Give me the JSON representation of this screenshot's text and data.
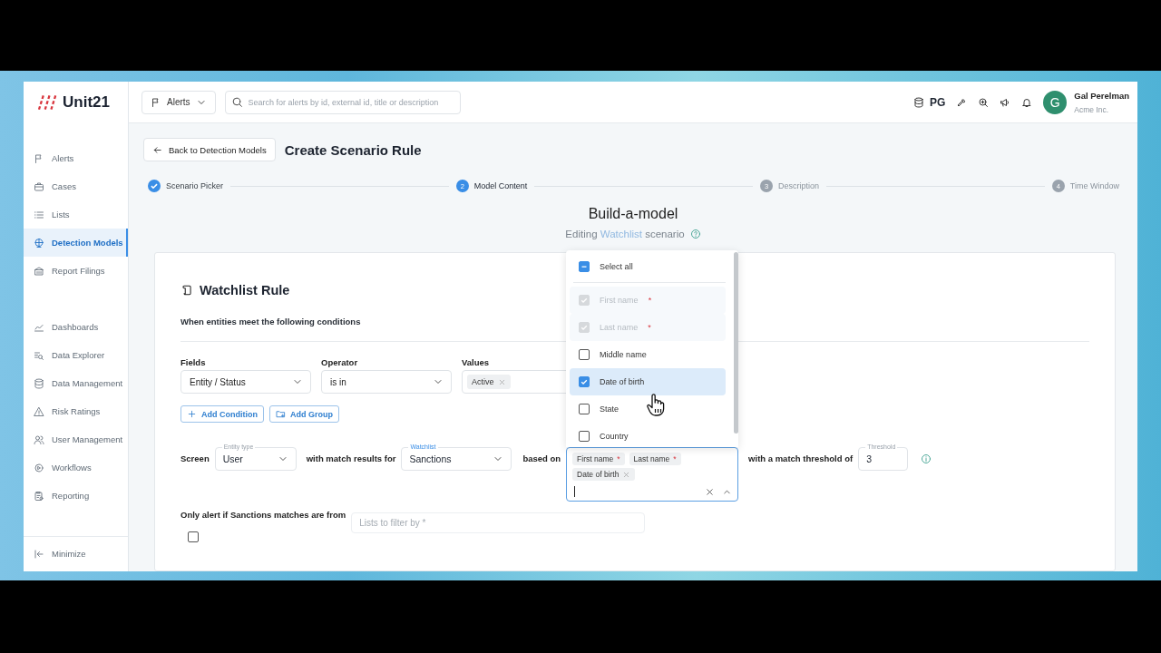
{
  "logo": {
    "text": "Unit21"
  },
  "header": {
    "menu": {
      "label": "Alerts"
    },
    "search": {
      "placeholder": "Search for alerts by id, external id, title or description"
    },
    "db_label": "PG",
    "user": {
      "initial": "G",
      "name": "Gal Perelman",
      "org": "Acme Inc."
    }
  },
  "sidebar": {
    "groups": [
      {
        "items": [
          {
            "label": "Alerts",
            "selected": false
          },
          {
            "label": "Cases",
            "selected": false
          },
          {
            "label": "Lists",
            "selected": false
          },
          {
            "label": "Detection Models",
            "selected": true
          },
          {
            "label": "Report Filings",
            "selected": false
          }
        ]
      },
      {
        "items": [
          {
            "label": "Dashboards",
            "selected": false
          },
          {
            "label": "Data Explorer",
            "selected": false
          },
          {
            "label": "Data Management",
            "selected": false
          },
          {
            "label": "Risk Ratings",
            "selected": false
          },
          {
            "label": "User Management",
            "selected": false
          },
          {
            "label": "Workflows",
            "selected": false
          },
          {
            "label": "Reporting",
            "selected": false
          }
        ]
      }
    ],
    "minimize": {
      "label": "Minimize"
    }
  },
  "page": {
    "back_button": "Back to Detection Models",
    "title": "Create Scenario Rule"
  },
  "stepper": [
    {
      "label": "Scenario Picker",
      "completed": true,
      "current": false
    },
    {
      "number": "2",
      "label": "Model Content",
      "completed": false,
      "current": true
    },
    {
      "number": "3",
      "label": "Description",
      "completed": false,
      "current": false
    },
    {
      "number": "4",
      "label": "Time Window",
      "completed": false,
      "current": false
    }
  ],
  "builder": {
    "title": "Build-a-model",
    "subtitle": {
      "prefix": "Editing",
      "link": "Watchlist",
      "suffix": "scenario"
    }
  },
  "rule": {
    "title": "Watchlist Rule",
    "description": "When entities meet the following conditions",
    "condition": {
      "fields": {
        "label": "Fields",
        "value": "Entity / Status"
      },
      "operator": {
        "label": "Operator",
        "value": "is in"
      },
      "values": {
        "label": "Values",
        "chips": [
          {
            "text": "Active"
          }
        ]
      }
    },
    "buttons": [
      {
        "label": "Add Condition",
        "kind": "condition"
      },
      {
        "label": "Add Group",
        "kind": "group"
      }
    ],
    "screen": {
      "screen_text": "Screen",
      "entity_type": {
        "label": "Entity type",
        "value": "User",
        "highlighted": false
      },
      "match_text": "with match results for",
      "watchlist": {
        "label": "Watchlist",
        "value": "Sanctions",
        "highlighted": true
      },
      "based_on_text": "based on",
      "pii": {
        "focused": true,
        "chips": [
          {
            "text": "First name",
            "required_mark": "*",
            "removable": false
          },
          {
            "text": "Last name",
            "required_mark": "*",
            "removable": false
          },
          {
            "text": "Date of birth",
            "removable": true
          }
        ]
      },
      "threshold_text": "with a match threshold of",
      "threshold": {
        "label": "Threshold",
        "value": "3"
      }
    },
    "pii_dropdown": {
      "select_all": {
        "label": "Select all",
        "indeterminate": true
      },
      "options": [
        {
          "label": "First name",
          "required_mark": "*",
          "checked": true,
          "disabled": true,
          "selected": false
        },
        {
          "label": "Last name",
          "required_mark": "*",
          "checked": true,
          "disabled": true,
          "selected": false
        },
        {
          "label": "Middle name",
          "checked": false,
          "disabled": false,
          "selected": false
        },
        {
          "label": "Date of birth",
          "checked": true,
          "disabled": false,
          "selected": true
        },
        {
          "label": "State",
          "checked": false,
          "disabled": false,
          "selected": false
        },
        {
          "label": "Country",
          "checked": false,
          "disabled": false,
          "selected": false
        }
      ]
    },
    "filter": {
      "label": "Only alert if Sanctions matches are from",
      "checked": false,
      "placeholder": "Lists to filter by *"
    }
  }
}
